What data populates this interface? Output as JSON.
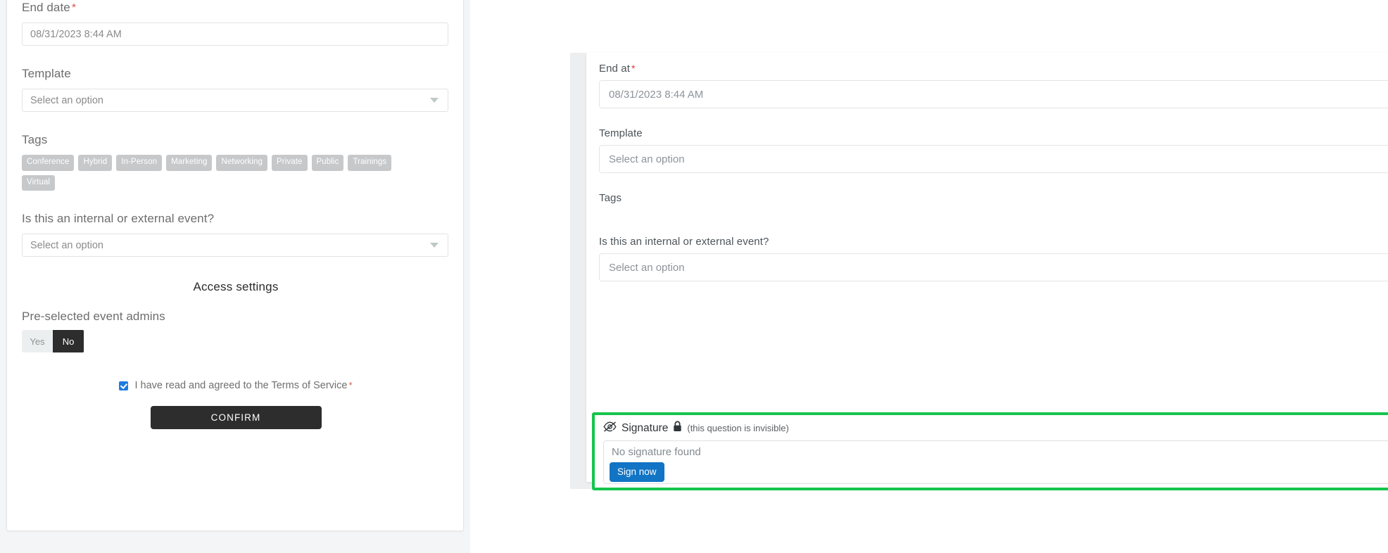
{
  "left_form": {
    "end_date": {
      "label": "End date",
      "required_marker": "*",
      "value": "08/31/2023 8:44 AM"
    },
    "template": {
      "label": "Template",
      "placeholder": "Select an option"
    },
    "tags": {
      "label": "Tags",
      "items": [
        "Conference",
        "Hybrid",
        "In-Person",
        "Marketing",
        "Networking",
        "Private",
        "Public",
        "Trainings",
        "Virtual"
      ]
    },
    "event_type": {
      "label": "Is this an internal or external event?",
      "placeholder": "Select an option"
    },
    "access_settings": {
      "section_title": "Access settings",
      "pre_selected_admins": {
        "label": "Pre-selected event admins",
        "options": [
          "Yes",
          "No"
        ],
        "selected": "No"
      }
    },
    "terms": {
      "text": "I have read and agreed to the Terms of Service",
      "required_marker": "*",
      "checked": true
    },
    "confirm_label": "CONFIRM"
  },
  "arrow": {
    "icon": "arrow-right-circle-icon",
    "color": "#16c44d"
  },
  "right_form": {
    "end_at": {
      "label": "End at",
      "required_marker": "*",
      "value": "08/31/2023 8:44 AM"
    },
    "template": {
      "label": "Template",
      "placeholder": "Select an option"
    },
    "tags": {
      "label": "Tags"
    },
    "event_type": {
      "label": "Is this an internal or external event?",
      "placeholder": "Select an option"
    },
    "signature": {
      "eye_icon": "eye-slash-icon",
      "title": "Signature",
      "lock_icon": "lock-icon",
      "note": "(this question is invisible)",
      "empty_text": "No signature found",
      "sign_button_label": "Sign now",
      "highlight_color": "#16c44d",
      "button_color": "#1274c4"
    }
  }
}
